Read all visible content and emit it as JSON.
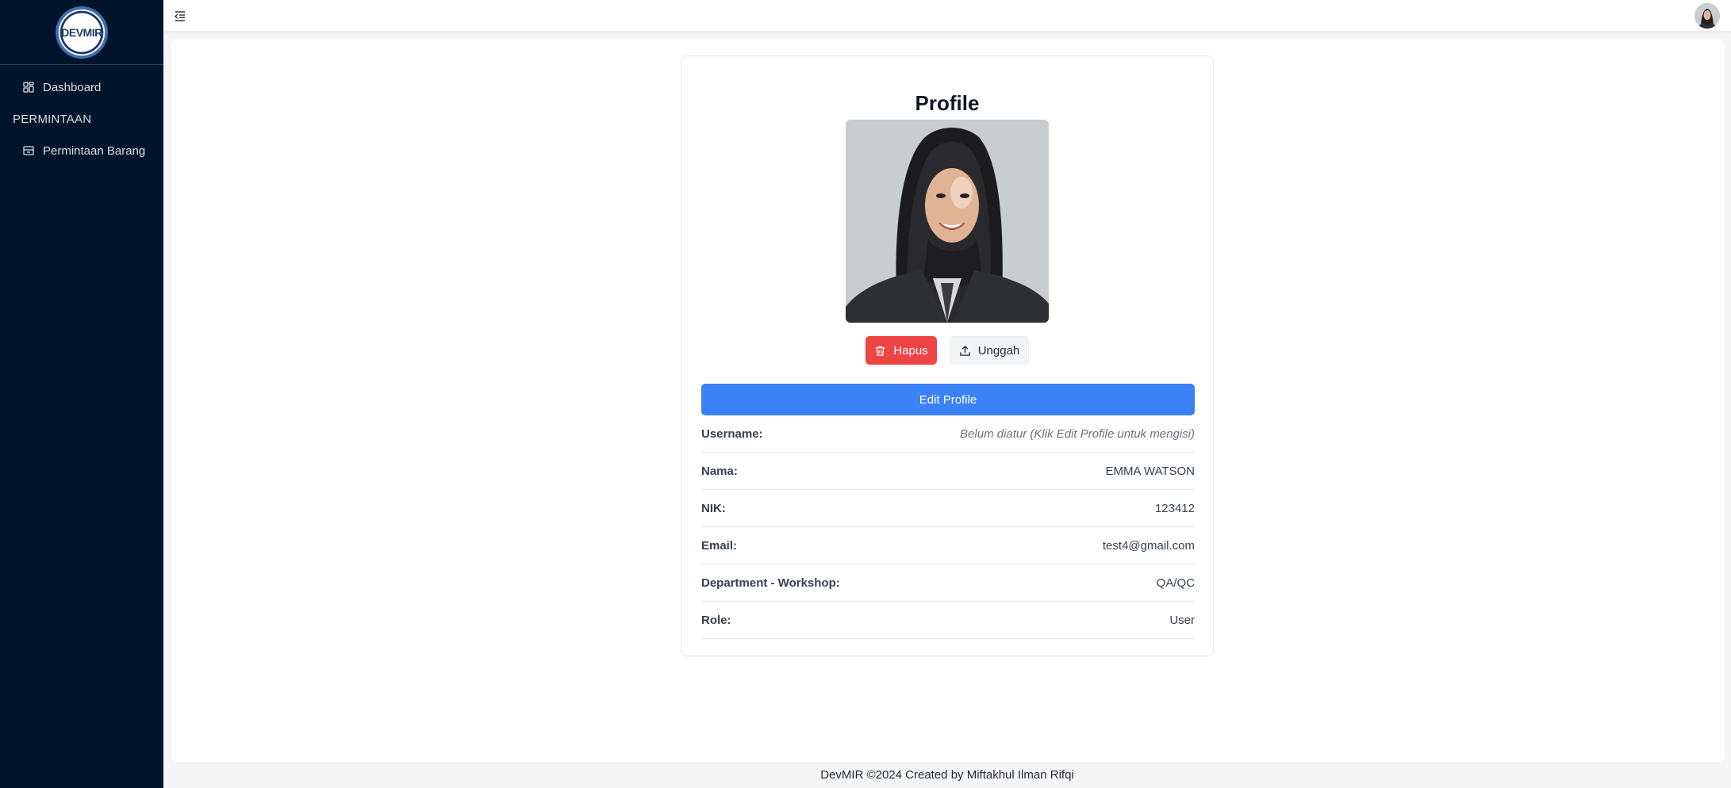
{
  "brand": {
    "logo_text": "DEVMIR"
  },
  "sidebar": {
    "items": [
      {
        "label": "Dashboard",
        "icon": "dashboard-icon"
      }
    ],
    "groups": [
      {
        "title": "PERMINTAAN",
        "items": [
          {
            "label": "Permintaan Barang",
            "icon": "inbox-icon"
          }
        ]
      }
    ]
  },
  "header": {
    "toggle_icon": "menu-fold-icon",
    "avatar": "user-avatar"
  },
  "profile": {
    "title": "Profile",
    "delete_label": "Hapus",
    "upload_label": "Unggah",
    "edit_label": "Edit Profile",
    "fields": [
      {
        "label": "Username:",
        "value": "Belum diatur (Klik Edit Profile untuk mengisi)"
      },
      {
        "label": "Nama:",
        "value": "EMMA WATSON"
      },
      {
        "label": "NIK:",
        "value": "123412"
      },
      {
        "label": "Email:",
        "value": "test4@gmail.com"
      },
      {
        "label": "Department - Workshop:",
        "value": "QA/QC"
      },
      {
        "label": "Role:",
        "value": "User"
      }
    ]
  },
  "footer": {
    "text": "DevMIR ©2024 Created by Miftakhul Ilman Rifqi"
  },
  "colors": {
    "sidebar_bg": "#001529",
    "danger": "#ef4444",
    "primary": "#3b82f6"
  }
}
